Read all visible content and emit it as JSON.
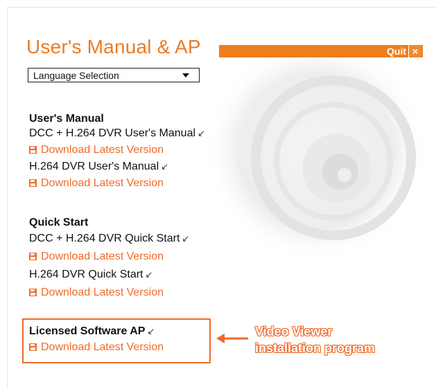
{
  "header": {
    "title": "User's Manual & AP",
    "quit_label": "Quit",
    "close_symbol": "×"
  },
  "language": {
    "selected": "Language Selection"
  },
  "sections": {
    "users_manual": {
      "heading": "User's Manual",
      "item1": "DCC + H.264 DVR User's Manual",
      "item2": "H.264 DVR User's Manual",
      "download_label": "Download Latest Version"
    },
    "quick_start": {
      "heading": "Quick Start",
      "item1": "DCC + H.264 DVR Quick Start",
      "item2": "H.264 DVR Quick Start",
      "download_label": "Download Latest Version"
    },
    "licensed_software": {
      "heading": "Licensed Software AP",
      "download_label": "Download Latest Version"
    }
  },
  "callout": {
    "line1": "Video Viewer",
    "line2": "installation program"
  },
  "icons": {
    "external": "external-link-arrow-icon",
    "save": "floppy-disk-icon"
  },
  "colors": {
    "accent": "#ef7a22",
    "link": "#ef6a2a",
    "text": "#111111"
  }
}
